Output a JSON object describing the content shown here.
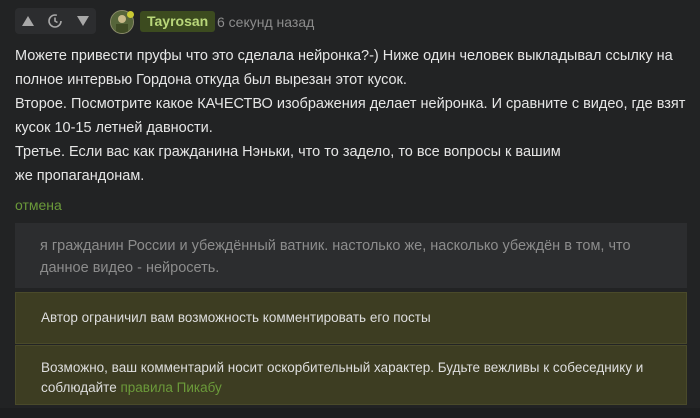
{
  "comment": {
    "author": "Tayrosan",
    "time": "6 секунд назад",
    "paragraphs": [
      "Можете привести пруфы что это сделала нейронка?-) Ниже один человек выкладывал ссылку на полное интервью Гордона откуда был вырезан этот кусок.",
      "Второе. Посмотрите какое КАЧЕСТВО изображения делает нейронка. И сравните с видео, где взят кусок 10-15 летней давности.",
      "Третье. Если вас как гражданина Нэньки, что то задело, то все вопросы к вашим",
      "же пропагандонам."
    ]
  },
  "cancel_label": "отмена",
  "reply_text": "я гражданин России и убеждённый ватник. настолько же, насколько убеждён в том, что данное видео - нейросеть.",
  "notices": {
    "restricted": "Автор ограничил вам возможность комментировать его посты",
    "offensive_prefix": "Возможно, ваш комментарий носит оскорбительный характер. Будьте вежливы к собеседнику и соблюдайте ",
    "rules_link": "правила Пикабу"
  },
  "icons": {
    "upvote": "triangle-up-icon",
    "history": "clock-history-icon",
    "downvote": "triangle-down-icon"
  },
  "colors": {
    "background": "#222324",
    "accent_green": "#6b9a3a",
    "author_badge_bg": "#3c4b1f",
    "author_badge_text": "#b9d77a",
    "notice_bg": "#3d3d22"
  }
}
